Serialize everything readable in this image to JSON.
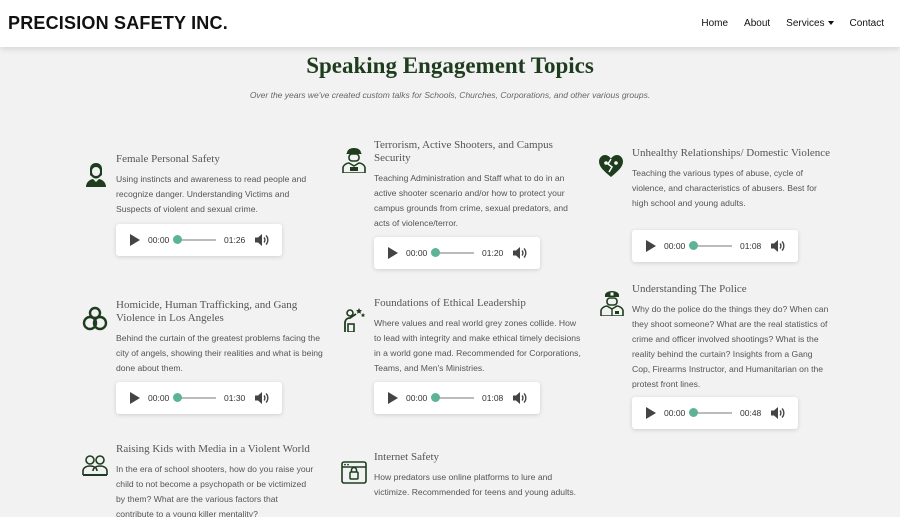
{
  "brand": "PRECISION SAFETY INC.",
  "nav": {
    "home": "Home",
    "about": "About",
    "services": "Services",
    "contact": "Contact"
  },
  "page": {
    "title": "Speaking Engagement Topics",
    "subtitle": "Over the years we've created custom talks for Schools, Churches, Corporations, and other various groups."
  },
  "topics": [
    {
      "icon": "woman-icon",
      "title": "Female Personal Safety",
      "desc": "Using instincts and awareness to read people and recognize danger. Understanding Victims and Suspects of violent and sexual crime.",
      "audio": {
        "current": "00:00",
        "duration": "01:26"
      }
    },
    {
      "icon": "soldier-icon",
      "title": "Terrorism, Active Shooters, and Campus Security",
      "desc": "Teaching Administration and Staff what to do in an active shooter scenario and/or how to protect your campus grounds from crime, sexual predators, and acts of violence/terror.",
      "audio": {
        "current": "00:00",
        "duration": "01:20"
      }
    },
    {
      "icon": "broken-heart-icon",
      "title": "Unhealthy Relationships/ Domestic Violence",
      "desc": "Teaching the various types of abuse, cycle of violence, and characteristics of abusers. Best for high school and young adults.",
      "audio": {
        "current": "00:00",
        "duration": "01:08"
      }
    },
    {
      "icon": "handcuffs-icon",
      "title": "Homicide, Human Trafficking, and Gang Violence in Los Angeles",
      "desc": "Behind the curtain of the greatest problems facing the city of angels, showing their realities and what is being done about them.",
      "audio": {
        "current": "00:00",
        "duration": "01:30"
      }
    },
    {
      "icon": "leader-icon",
      "title": "Foundations of Ethical Leadership",
      "desc": "Where values and real world grey zones collide. How to lead with integrity and make ethical timely decisions in a world gone mad. Recommended for Corporations, Teams, and Men's Ministries.",
      "audio": {
        "current": "00:00",
        "duration": "01:08"
      }
    },
    {
      "icon": "police-officer-icon",
      "title": "Understanding The Police",
      "desc": "Why do the police do the things they do? When can they shoot someone? What are the real statistics of crime and officer involved shootings? What is the reality behind the curtain? Insights from a Gang Cop, Firearms Instructor, and Humanitarian on the protest front lines.",
      "audio": {
        "current": "00:00",
        "duration": "00:48"
      }
    },
    {
      "icon": "family-icon",
      "title": "Raising Kids with Media in a Violent World",
      "desc": "In the era of school shooters, how do you raise your child to not become a psychopath or be victimized by them? What are the various factors that contribute to a young killer mentality?"
    },
    {
      "icon": "internet-lock-icon",
      "title": "Internet Safety",
      "desc": "How predators use online platforms to lure and victimize. Recommended for teens and young adults."
    }
  ]
}
